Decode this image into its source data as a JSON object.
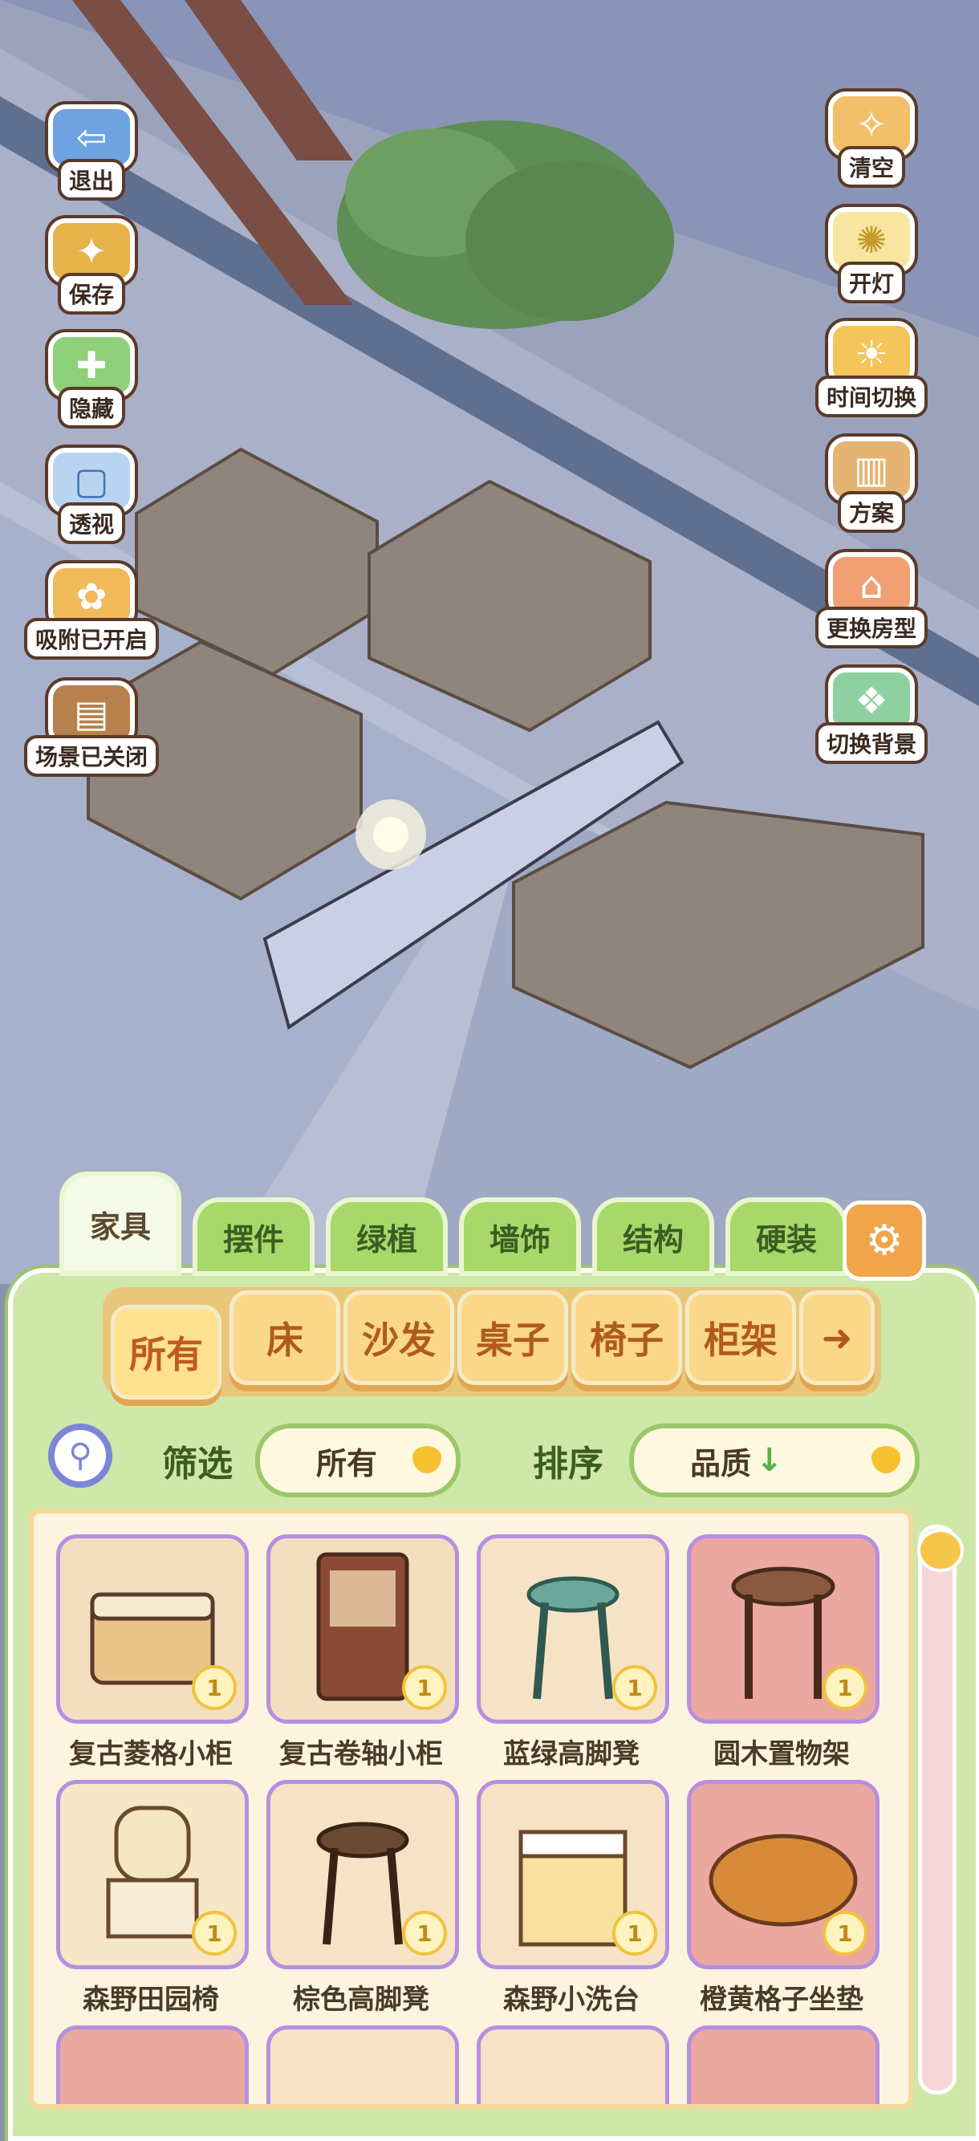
{
  "side_left": [
    {
      "label": "退出",
      "icon": "exit-door-icon"
    },
    {
      "label": "保存",
      "icon": "save-icon"
    },
    {
      "label": "隐藏",
      "icon": "hide-icon"
    },
    {
      "label": "透视",
      "icon": "perspective-cube-icon"
    },
    {
      "label": "吸附已开启",
      "icon": "snap-icon"
    },
    {
      "label": "场景已关闭",
      "icon": "scene-icon"
    }
  ],
  "side_right": [
    {
      "label": "清空",
      "icon": "clear-icon"
    },
    {
      "label": "开灯",
      "icon": "lamp-icon"
    },
    {
      "label": "时间切换",
      "icon": "time-switch-icon"
    },
    {
      "label": "方案",
      "icon": "plan-icon"
    },
    {
      "label": "更换房型",
      "icon": "house-icon"
    },
    {
      "label": "切换背景",
      "icon": "background-icon"
    }
  ],
  "tabs": [
    "家具",
    "摆件",
    "绿植",
    "墙饰",
    "结构",
    "硬装"
  ],
  "active_tab": "家具",
  "categories": [
    "所有",
    "床",
    "沙发",
    "桌子",
    "椅子",
    "柜架"
  ],
  "filter": {
    "label": "筛选",
    "value": "所有"
  },
  "sort": {
    "label": "排序",
    "value": "品质"
  },
  "items": [
    {
      "name": "复古菱格小柜",
      "qty": "1",
      "bg": "#f3dfc0"
    },
    {
      "name": "复古卷轴小柜",
      "qty": "1",
      "bg": "#f3dfc0"
    },
    {
      "name": "蓝绿高脚凳",
      "qty": "1",
      "bg": "#f6e3c6"
    },
    {
      "name": "圆木置物架",
      "qty": "1",
      "bg": "#eaa8a0"
    },
    {
      "name": "森野田园椅",
      "qty": "1",
      "bg": "#f6e7c8"
    },
    {
      "name": "棕色高脚凳",
      "qty": "1",
      "bg": "#f6e3c6"
    },
    {
      "name": "森野小洗台",
      "qty": "1",
      "bg": "#f6e3c6"
    },
    {
      "name": "橙黄格子坐垫",
      "qty": "1",
      "bg": "#eaa8a0"
    }
  ],
  "colors": {
    "panel": "#cfe7a8",
    "tab": "#a8d86a",
    "accent": "#f0a54a",
    "card_border": "#b68fe0"
  }
}
